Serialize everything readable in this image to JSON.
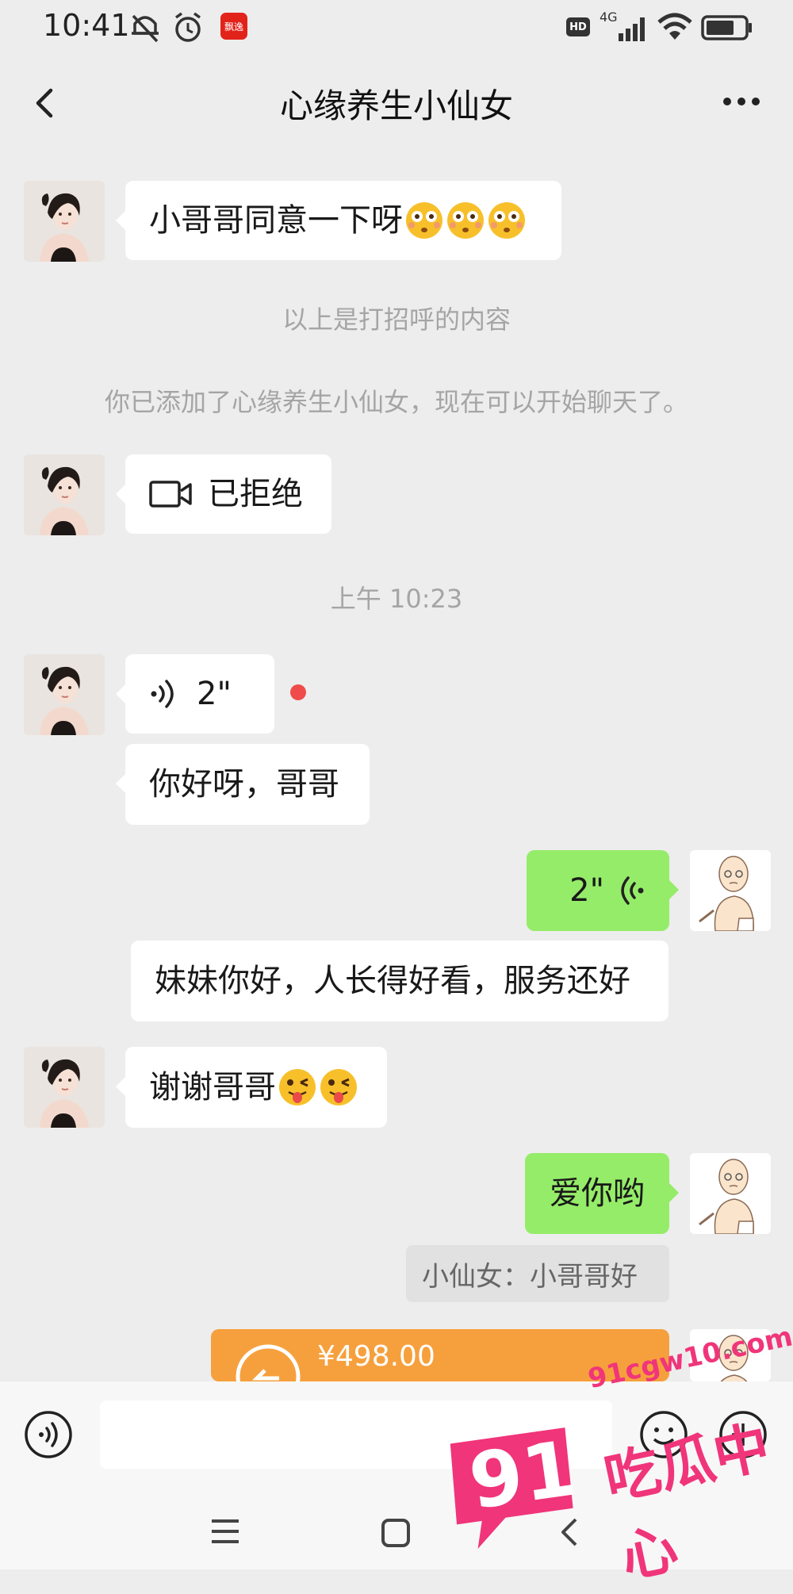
{
  "status_bar": {
    "time": "10:41",
    "app_badge": "飘逸",
    "hd_badge": "HD",
    "network": "4G"
  },
  "header": {
    "title": "心缘养生小仙女"
  },
  "messages": {
    "m1": {
      "text": "小哥哥同意一下呀"
    },
    "sys1": "以上是打招呼的内容",
    "sys2": "你已添加了心缘养生小仙女，现在可以开始聊天了。",
    "m2": {
      "text": "已拒绝",
      "icon": "video-call-icon"
    },
    "time1": "上午 10:23",
    "m3": {
      "duration": "2\"",
      "icon": "voice-icon"
    },
    "m4": {
      "text": "你好呀，哥哥"
    },
    "m5": {
      "duration": "2\"",
      "icon": "voice-icon"
    },
    "m6": {
      "text": "妹妹你好，人长得好看，服务还好"
    },
    "m7": {
      "text": "谢谢哥哥"
    },
    "m8": {
      "text": "爱你哟"
    },
    "m8_quote": "小仙女：小哥哥好",
    "m9": {
      "amount": "¥498.00"
    }
  },
  "watermark": {
    "number": "91",
    "url": "91cgw10.com",
    "label": "吃瓜中心"
  },
  "colors": {
    "background": "#ededed",
    "bubble_in": "#ffffff",
    "bubble_out": "#95ec69",
    "transfer": "#f6a03d",
    "unread_dot": "#f04b4b",
    "watermark": "#f0357a"
  }
}
